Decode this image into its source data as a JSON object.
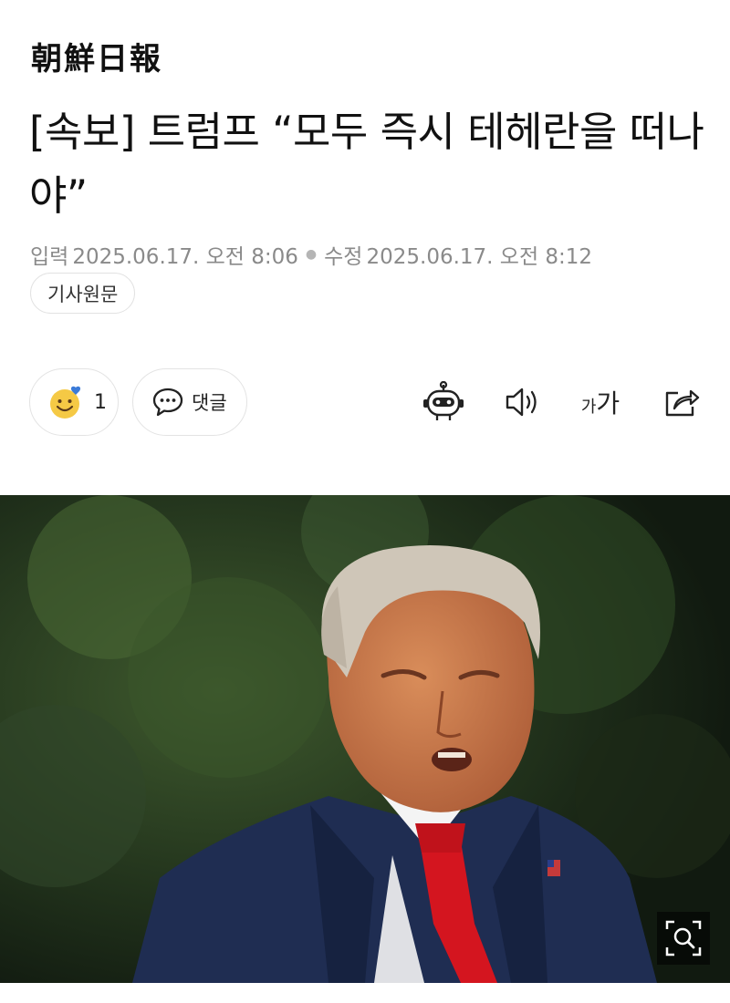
{
  "masthead": {
    "logo_text": "朝鮮日報"
  },
  "article": {
    "headline": "[속보] 트럼프 “모두 즉시 테헤란을 떠나야”",
    "input_label": "입력",
    "input_time": "2025.06.17. 오전 8:06",
    "modified_label": "수정",
    "modified_time": "2025.06.17. 오전 8:12",
    "original_button": "기사원문"
  },
  "actions": {
    "reaction_count": "1",
    "comment_label": "댓글",
    "font_size_small": "가",
    "font_size_large": "가"
  },
  "icons": {
    "reaction": "smiley-heart-icon",
    "comment": "speech-bubble-icon",
    "summary": "robot-icon",
    "listen": "speaker-icon",
    "font_size": "font-size-icon",
    "share": "share-icon",
    "zoom": "zoom-icon"
  },
  "colors": {
    "smiley": "#f5c945",
    "heart": "#3b7bd8",
    "meta_text": "#8a8a8a",
    "suit": "#1f2d52",
    "tie": "#d4151f"
  }
}
